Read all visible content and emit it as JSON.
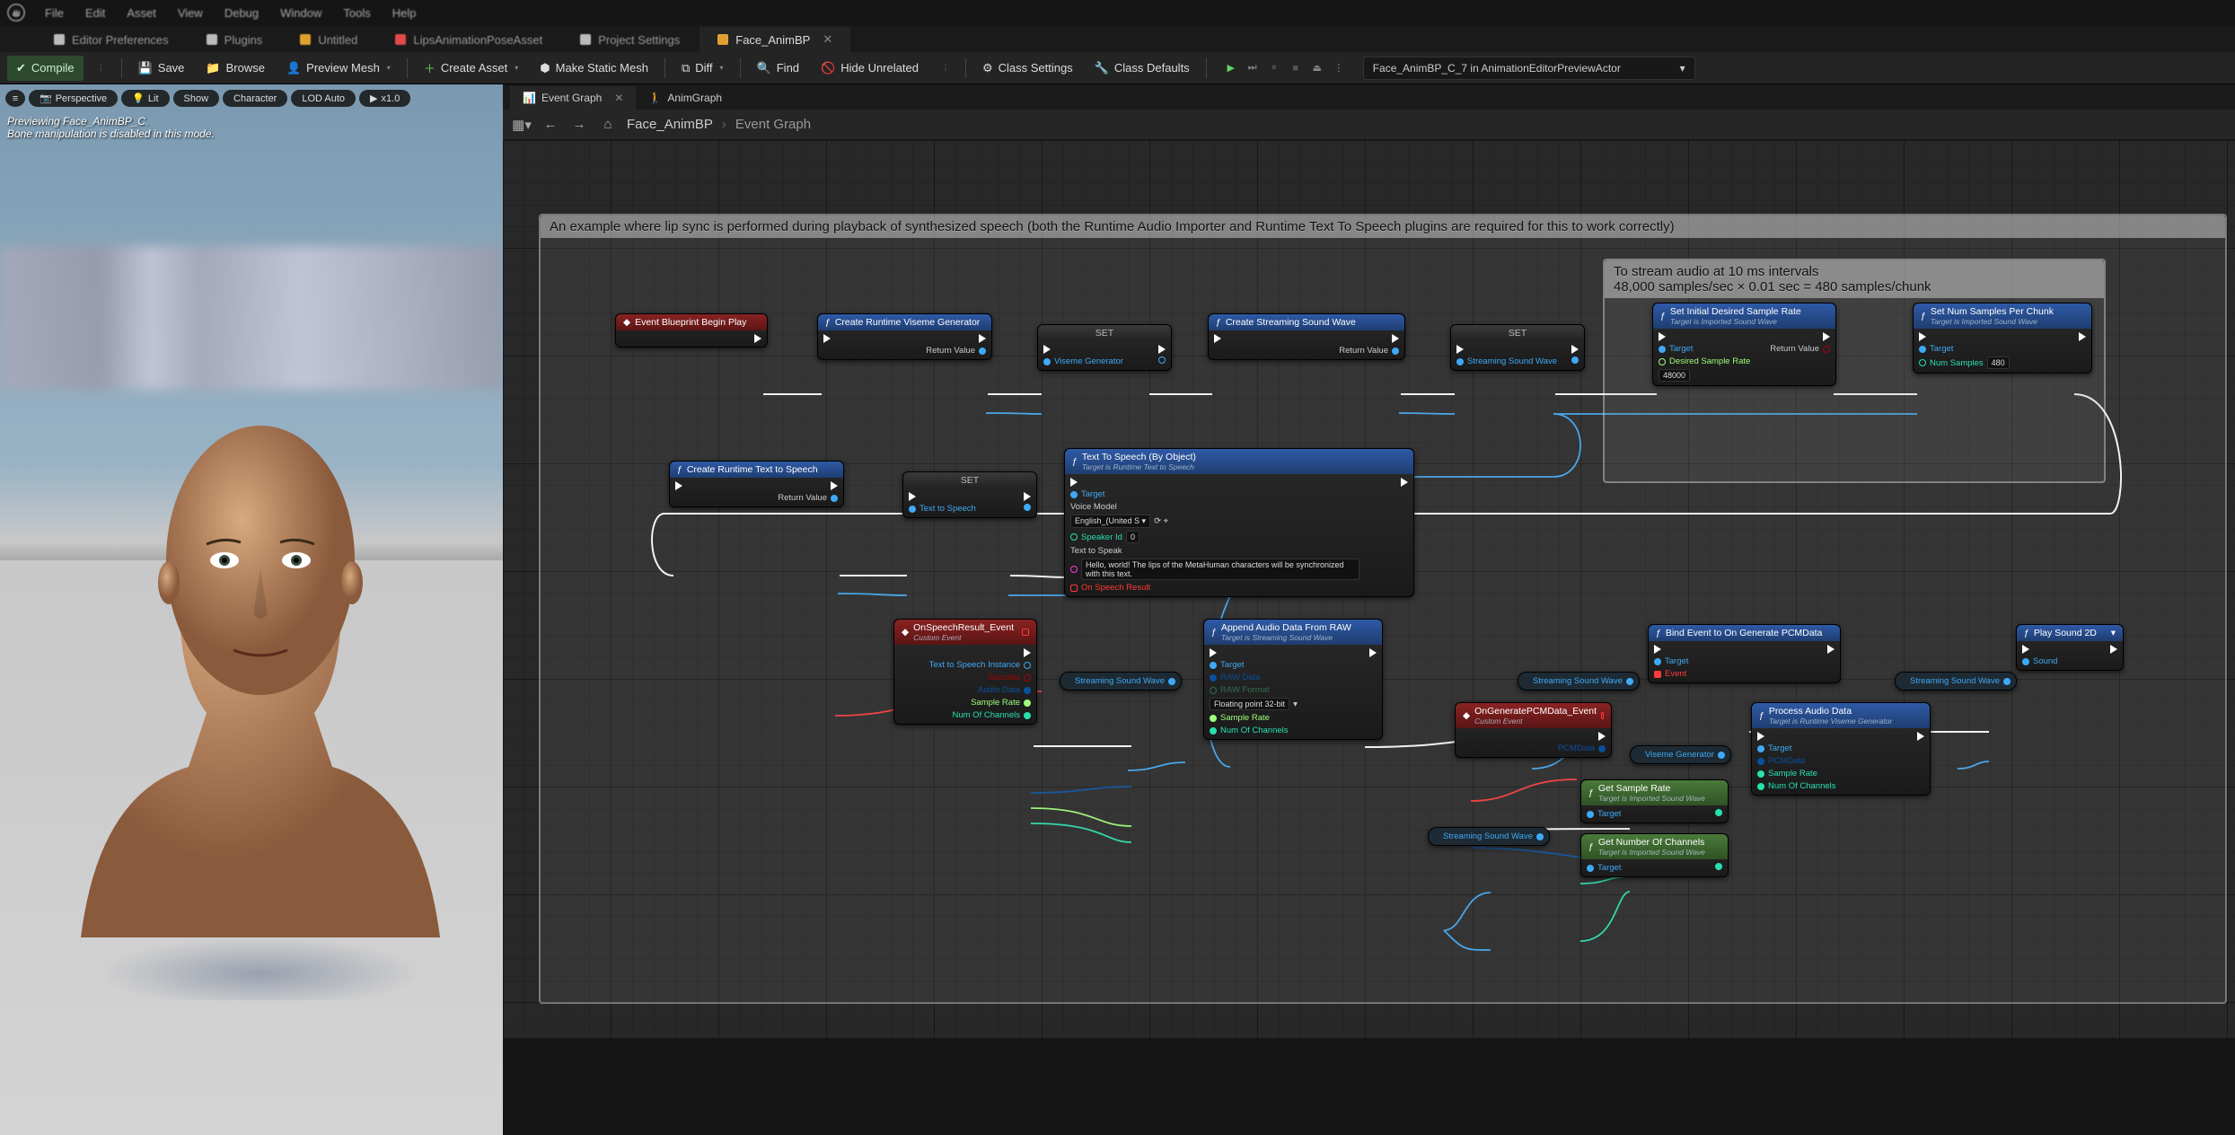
{
  "menubar": {
    "items": [
      "File",
      "Edit",
      "Asset",
      "View",
      "Debug",
      "Window",
      "Tools",
      "Help"
    ]
  },
  "filetabs": {
    "items": [
      {
        "label": "Editor Preferences",
        "icon": "#bbb"
      },
      {
        "label": "Plugins",
        "icon": "#bbb"
      },
      {
        "label": "Untitled",
        "icon": "#e0a030"
      },
      {
        "label": "LipsAnimationPoseAsset",
        "icon": "#e04a4a"
      },
      {
        "label": "Project Settings",
        "icon": "#bbb"
      },
      {
        "label": "Face_AnimBP",
        "icon": "#e0a030",
        "active": true
      }
    ]
  },
  "toolbar": {
    "compile": "Compile",
    "save": "Save",
    "browse": "Browse",
    "preview_mesh": "Preview Mesh",
    "create_asset": "Create Asset",
    "make_static_mesh": "Make Static Mesh",
    "diff": "Diff",
    "find": "Find",
    "hide_unrelated": "Hide Unrelated",
    "class_settings": "Class Settings",
    "class_defaults": "Class Defaults",
    "asset_combo": "Face_AnimBP_C_7 in AnimationEditorPreviewActor"
  },
  "viewport": {
    "buttons": {
      "perspective": "Perspective",
      "lit": "Lit",
      "show": "Show",
      "character": "Character",
      "lod": "LOD Auto",
      "speed": "x1.0"
    },
    "overlay_line1": "Previewing Face_AnimBP_C.",
    "overlay_line2": "Bone manipulation is disabled in this mode."
  },
  "graph": {
    "tabs": {
      "event_graph": "Event Graph",
      "anim_graph": "AnimGraph"
    },
    "breadcrumb": {
      "asset": "Face_AnimBP",
      "graph": "Event Graph"
    },
    "comment_main": "An example where lip sync is performed during playback of synthesized speech (both the Runtime Audio Importer and Runtime Text To Speech plugins are required for this to work correctly)",
    "comment_chunk_line1": "To stream audio at 10 ms intervals",
    "comment_chunk_line2": "48,000 samples/sec × 0.01 sec = 480 samples/chunk",
    "nodes": {
      "begin_play": "Event Blueprint Begin Play",
      "create_viseme": "Create Runtime Viseme Generator",
      "set": "SET",
      "viseme_generator": "Viseme Generator",
      "create_stream_wave": "Create Streaming Sound Wave",
      "streaming_sound_wave": "Streaming Sound Wave",
      "set_initial_rate": "Set Initial Desired Sample Rate",
      "target_imported": "Target is Imported Sound Wave",
      "set_num_samples": "Set Num Samples Per Chunk",
      "create_tts": "Create Runtime Text to Speech",
      "text_to_speech_var": "Text to Speech",
      "tts_by_object": "Text To Speech (By Object)",
      "tts_target": "Target is Runtime Text to Speech",
      "voice_model": "Voice Model",
      "voice_model_val": "English_(United S",
      "speaker_id": "Speaker Id",
      "speaker_id_val": "0",
      "text_to_speak": "Text to Speak",
      "text_to_speak_val": "Hello, world! The lips of the MetaHuman characters will be synchronized with this text.",
      "on_speech_result": "On Speech Result",
      "on_speech_event": "OnSpeechResult_Event",
      "custom_event": "Custom Event",
      "tts_instance": "Text to Speech Instance",
      "success": "Success",
      "audio_data": "Audio Data",
      "sample_rate": "Sample Rate",
      "num_channels": "Num Of Channels",
      "append_audio": "Append Audio Data From RAW",
      "target_streaming": "Target is Streaming Sound Wave",
      "raw_data": "RAW Data",
      "raw_format": "RAW Format",
      "raw_format_val": "Floating point 32-bit",
      "bind_event": "Bind Event to On Generate PCMData",
      "event_pin": "Event",
      "play_sound": "Play Sound 2D",
      "sound": "Sound",
      "on_pcm_event": "OnGeneratePCMData_Event",
      "pcm_data": "PCMData",
      "process_audio": "Process Audio Data",
      "target_viseme": "Target is Runtime Viseme Generator",
      "get_sample_rate": "Get Sample Rate",
      "get_num_channels": "Get Number Of Channels",
      "return_value": "Return Value",
      "target": "Target",
      "desired_rate": "Desired Sample Rate",
      "desired_rate_val": "48000",
      "num_samples": "Num Samples",
      "num_samples_val": "480"
    }
  }
}
